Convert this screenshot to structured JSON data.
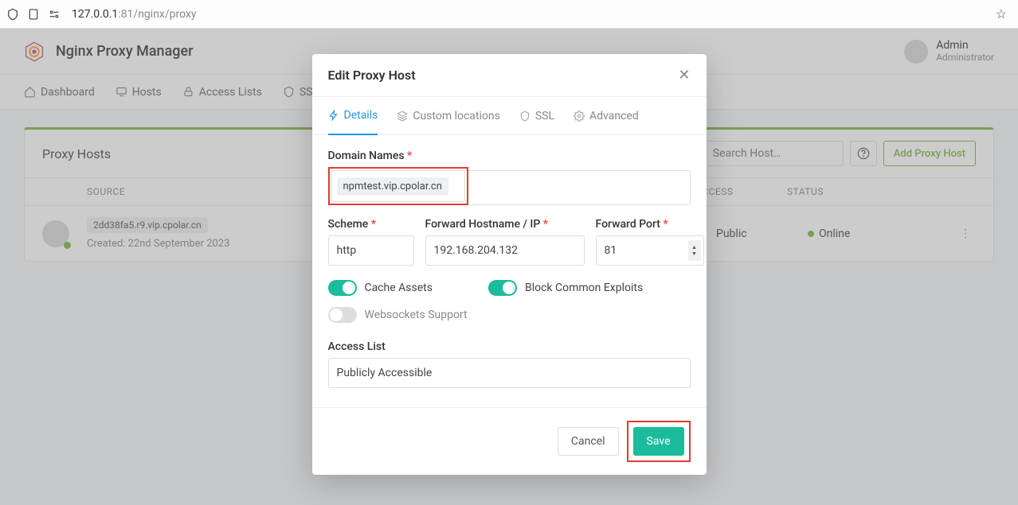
{
  "browser": {
    "url_dim_prefix": "127.0.0.1",
    "url_rest": ":81/nginx/proxy"
  },
  "header": {
    "app_title": "Nginx Proxy Manager",
    "user_name": "Admin",
    "user_role": "Administrator"
  },
  "nav": {
    "dashboard": "Dashboard",
    "hosts": "Hosts",
    "access_lists": "Access Lists",
    "ssl": "SSL"
  },
  "card": {
    "title": "Proxy Hosts",
    "search_placeholder": "Search Host…",
    "add_btn": "Add Proxy Host",
    "col_source": "SOURCE",
    "col_access": "ACCESS",
    "col_status": "STATUS",
    "row_domain": "2dd38fa5.r9.vip.cpolar.cn",
    "row_created": "Created: 22nd September 2023",
    "row_access": "Public",
    "row_status": "Online"
  },
  "modal": {
    "title": "Edit Proxy Host",
    "tabs": {
      "details": "Details",
      "custom": "Custom locations",
      "ssl": "SSL",
      "advanced": "Advanced"
    },
    "labels": {
      "domain_names": "Domain Names",
      "scheme": "Scheme",
      "forward_host": "Forward Hostname / IP",
      "forward_port": "Forward Port",
      "cache_assets": "Cache Assets",
      "block_exploits": "Block Common Exploits",
      "websockets": "Websockets Support",
      "access_list": "Access List"
    },
    "values": {
      "domain_chip": "npmtest.vip.cpolar.cn",
      "scheme": "http",
      "forward_host": "192.168.204.132",
      "forward_port": "81",
      "access_list": "Publicly Accessible"
    },
    "buttons": {
      "cancel": "Cancel",
      "save": "Save"
    }
  }
}
